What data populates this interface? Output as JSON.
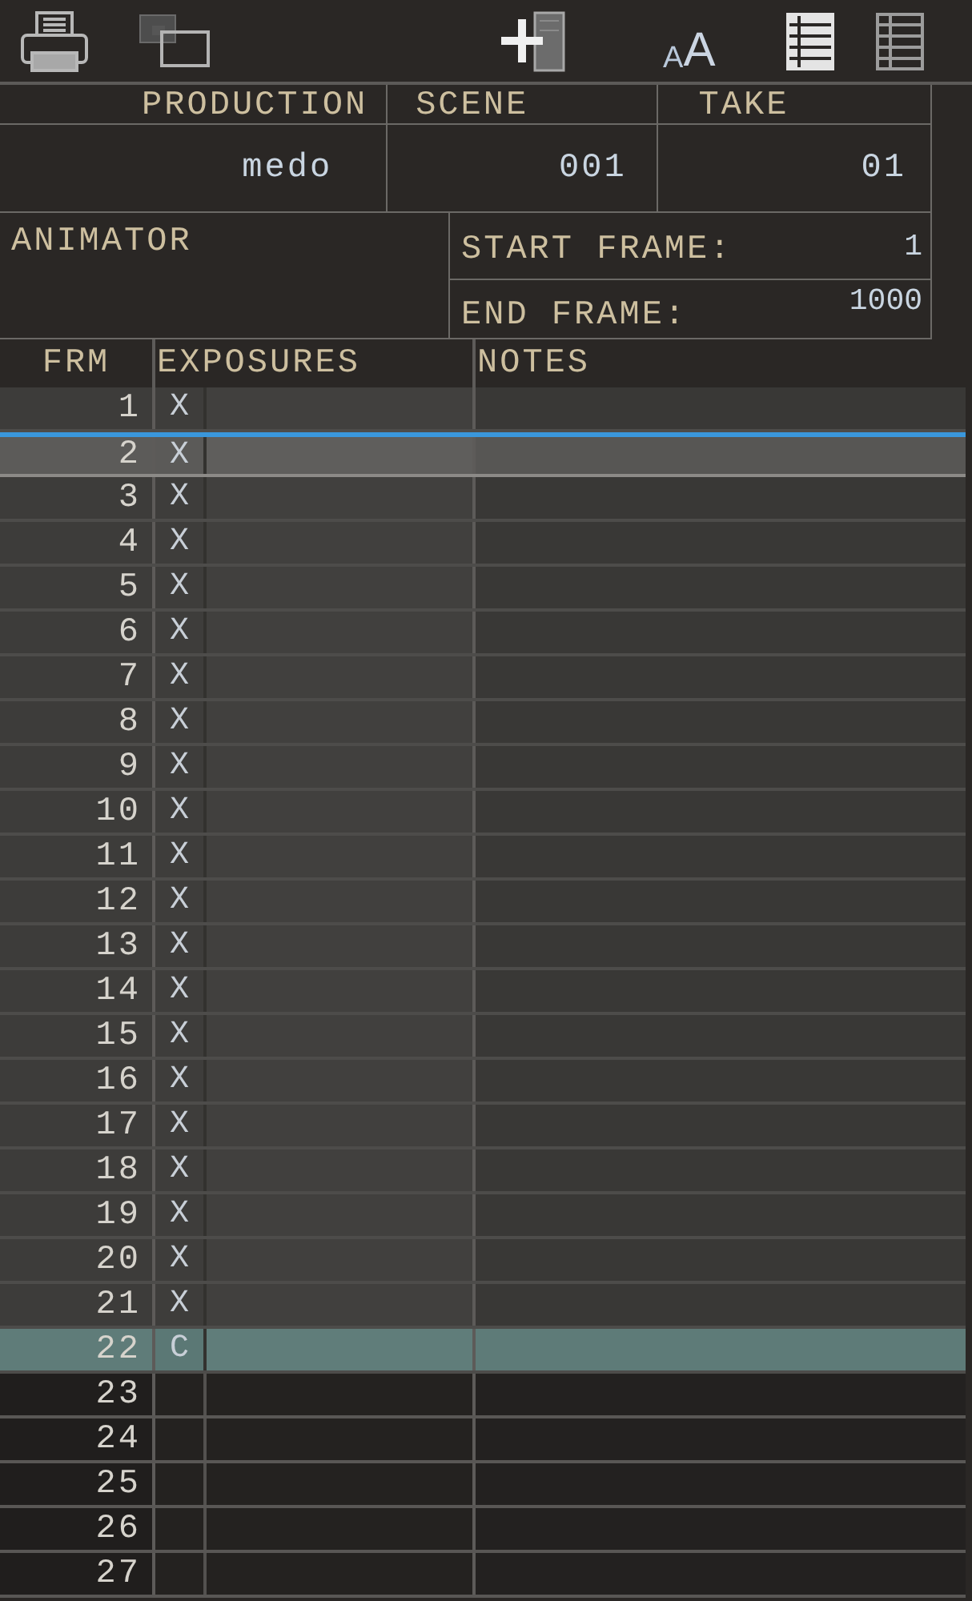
{
  "toolbar": {
    "buttons": [
      {
        "kind": "print"
      },
      {
        "kind": "windows"
      },
      {
        "kind": "add-column"
      },
      {
        "kind": "text-size",
        "glyphs": [
          "A",
          "A"
        ]
      }
    ],
    "view_buttons": [
      {
        "selected": true
      },
      {
        "selected": false
      }
    ]
  },
  "header": {
    "production": {
      "label": "PRODUCTION",
      "value": "medo"
    },
    "scene": {
      "label": "SCENE",
      "value": "001"
    },
    "take": {
      "label": "TAKE",
      "value": "01"
    },
    "animator": {
      "label": "ANIMATOR"
    },
    "start_frame": {
      "label": "START FRAME:",
      "value": "1"
    },
    "end_frame": {
      "label": "END FRAME:",
      "value": "1000"
    }
  },
  "sheet": {
    "columns": [
      "FRM",
      "EXPOSURES",
      "NOTES"
    ],
    "rows": [
      {
        "frame": "1",
        "exposure": "X",
        "kind": "exposed",
        "selected": false,
        "highlighted": false
      },
      {
        "frame": "2",
        "exposure": "X",
        "kind": "exposed",
        "selected": true,
        "highlighted": false
      },
      {
        "frame": "3",
        "exposure": "X",
        "kind": "exposed",
        "selected": false,
        "highlighted": false
      },
      {
        "frame": "4",
        "exposure": "X",
        "kind": "exposed",
        "selected": false,
        "highlighted": false
      },
      {
        "frame": "5",
        "exposure": "X",
        "kind": "exposed",
        "selected": false,
        "highlighted": false
      },
      {
        "frame": "6",
        "exposure": "X",
        "kind": "exposed",
        "selected": false,
        "highlighted": false
      },
      {
        "frame": "7",
        "exposure": "X",
        "kind": "exposed",
        "selected": false,
        "highlighted": false
      },
      {
        "frame": "8",
        "exposure": "X",
        "kind": "exposed",
        "selected": false,
        "highlighted": false
      },
      {
        "frame": "9",
        "exposure": "X",
        "kind": "exposed",
        "selected": false,
        "highlighted": false
      },
      {
        "frame": "10",
        "exposure": "X",
        "kind": "exposed",
        "selected": false,
        "highlighted": false
      },
      {
        "frame": "11",
        "exposure": "X",
        "kind": "exposed",
        "selected": false,
        "highlighted": false
      },
      {
        "frame": "12",
        "exposure": "X",
        "kind": "exposed",
        "selected": false,
        "highlighted": false
      },
      {
        "frame": "13",
        "exposure": "X",
        "kind": "exposed",
        "selected": false,
        "highlighted": false
      },
      {
        "frame": "14",
        "exposure": "X",
        "kind": "exposed",
        "selected": false,
        "highlighted": false
      },
      {
        "frame": "15",
        "exposure": "X",
        "kind": "exposed",
        "selected": false,
        "highlighted": false
      },
      {
        "frame": "16",
        "exposure": "X",
        "kind": "exposed",
        "selected": false,
        "highlighted": false
      },
      {
        "frame": "17",
        "exposure": "X",
        "kind": "exposed",
        "selected": false,
        "highlighted": false
      },
      {
        "frame": "18",
        "exposure": "X",
        "kind": "exposed",
        "selected": false,
        "highlighted": false
      },
      {
        "frame": "19",
        "exposure": "X",
        "kind": "exposed",
        "selected": false,
        "highlighted": false
      },
      {
        "frame": "20",
        "exposure": "X",
        "kind": "exposed",
        "selected": false,
        "highlighted": false
      },
      {
        "frame": "21",
        "exposure": "X",
        "kind": "exposed",
        "selected": false,
        "highlighted": false
      },
      {
        "frame": "22",
        "exposure": "C",
        "kind": "exposed",
        "selected": false,
        "highlighted": true
      },
      {
        "frame": "23",
        "kind": "blank",
        "selected": false,
        "highlighted": false
      },
      {
        "frame": "24",
        "kind": "blank",
        "selected": false,
        "highlighted": false
      },
      {
        "frame": "25",
        "kind": "blank",
        "selected": false,
        "highlighted": false
      },
      {
        "frame": "26",
        "kind": "blank",
        "selected": false,
        "highlighted": false
      },
      {
        "frame": "27",
        "kind": "blank",
        "selected": false,
        "highlighted": false
      }
    ]
  }
}
